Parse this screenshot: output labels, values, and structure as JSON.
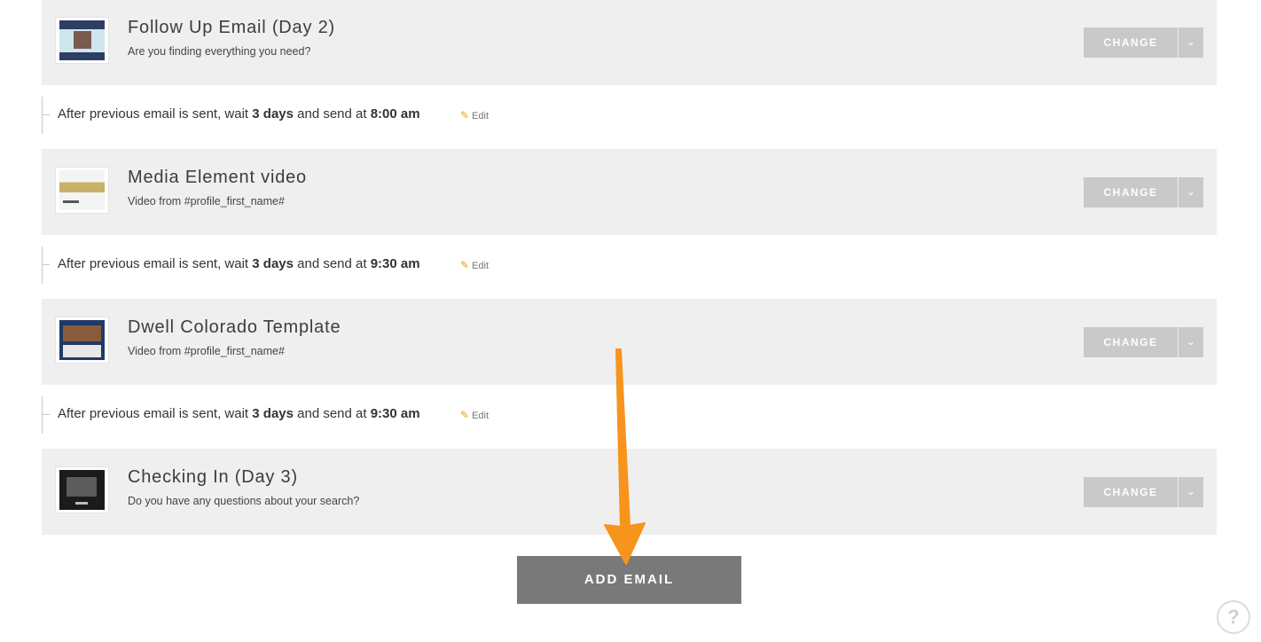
{
  "emails": [
    {
      "title": "Follow Up Email (Day 2)",
      "subject": "Are you finding everything you need?",
      "change_label": "CHANGE",
      "caret": "⌄",
      "thumb_icon": "email-thumbnail-icon"
    },
    {
      "title": "Media Element video",
      "subject": "Video from #profile_first_name#",
      "change_label": "CHANGE",
      "caret": "⌄",
      "thumb_icon": "email-thumbnail-icon"
    },
    {
      "title": "Dwell Colorado Template",
      "subject": "Video from #profile_first_name#",
      "change_label": "CHANGE",
      "caret": "⌄",
      "thumb_icon": "email-thumbnail-icon"
    },
    {
      "title": "Checking In (Day 3)",
      "subject": "Do you have any questions about your search?",
      "change_label": "CHANGE",
      "caret": "⌄",
      "thumb_icon": "email-thumbnail-icon"
    }
  ],
  "waits": [
    {
      "prefix": "After previous email is sent, wait",
      "days": "3 days",
      "middle": "and send at",
      "time": "8:00 am",
      "edit_label": "Edit"
    },
    {
      "prefix": "After previous email is sent, wait",
      "days": "3 days",
      "middle": "and send at",
      "time": "9:30 am",
      "edit_label": "Edit"
    },
    {
      "prefix": "After previous email is sent, wait",
      "days": "3 days",
      "middle": "and send at",
      "time": "9:30 am",
      "edit_label": "Edit"
    }
  ],
  "add_email_label": "ADD EMAIL",
  "help_label": "?",
  "colors": {
    "annotation_arrow": "#f7941d",
    "card_bg": "#efefef",
    "button_gray": "#c9c9c9",
    "add_button": "#7a7979"
  }
}
